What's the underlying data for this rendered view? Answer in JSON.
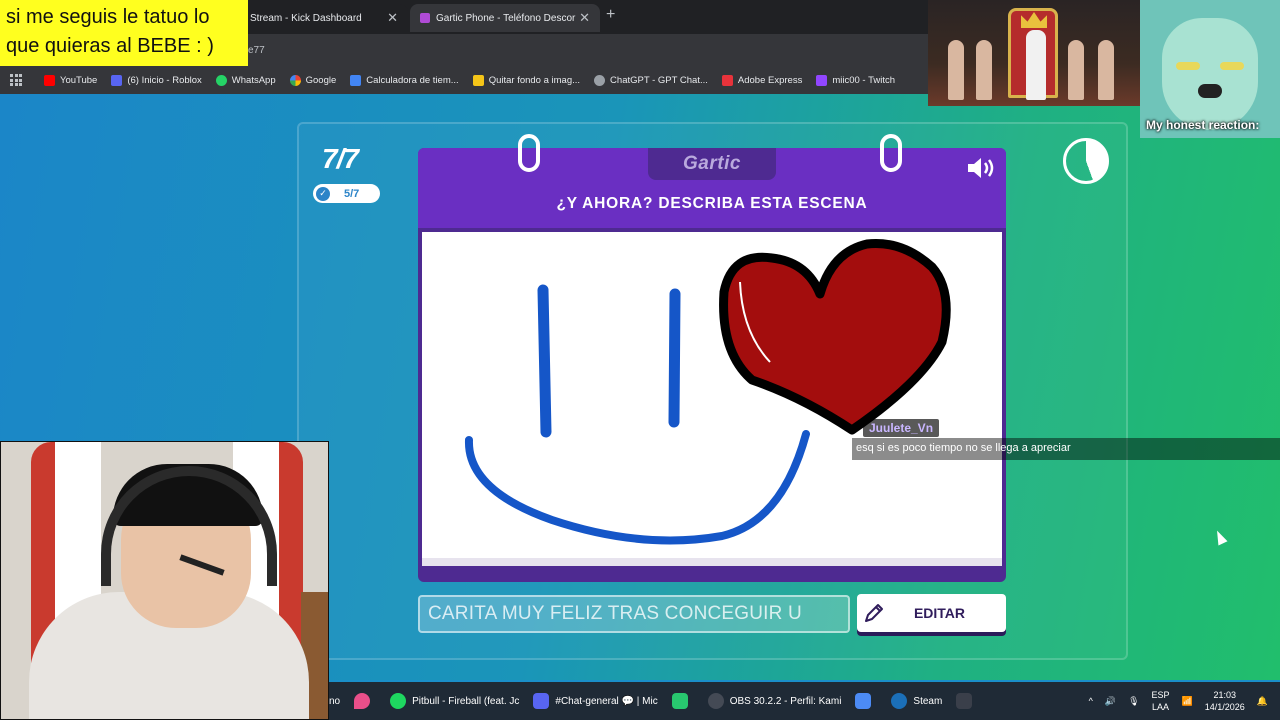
{
  "browser": {
    "tabs": [
      {
        "title": "Stream - Kick Dashboard"
      },
      {
        "title": "Gartic Phone - Teléfono Descor"
      }
    ],
    "address_partial": "e77",
    "bookmarks": [
      {
        "label": "YouTube",
        "color": "#ff0000"
      },
      {
        "label": "(6) Inicio - Roblox",
        "color": "#5865f2"
      },
      {
        "label": "WhatsApp",
        "color": "#25d366"
      },
      {
        "label": "Google",
        "color": "#ffffff"
      },
      {
        "label": "Calculadora de tiem...",
        "color": "#4285f4"
      },
      {
        "label": "Quitar fondo a imag...",
        "color": "#f5c518"
      },
      {
        "label": "ChatGPT - GPT Chat...",
        "color": "#9aa0a6"
      },
      {
        "label": "Adobe Express",
        "color": "#e8333b"
      },
      {
        "label": "miic00 - Twitch",
        "color": "#9146ff"
      }
    ]
  },
  "game": {
    "round": "7/7",
    "done_count": "5/7",
    "logo": "Gartic",
    "instruction": "¿Y AHORA? DESCRIBA ESTA ESCENA",
    "answer_text": "CARITA MUY FELIZ TRAS CONCEGUIR  U",
    "edit_label": "EDITAR"
  },
  "overlays": {
    "banner_text": "si me seguis le tatuo lo que quieras al BEBE : )",
    "reaction_text": "My honest reaction:",
    "chat": {
      "username": "Juulete_Vn",
      "message": "esq si es poco tiempo no se llega a apreciar"
    }
  },
  "taskbar": {
    "items": [
      {
        "label": "no",
        "color": "#1f2a36"
      },
      {
        "label": "",
        "color": "#e94f8a"
      },
      {
        "label": "Pitbull - Fireball (feat. Jc",
        "color": "#1ed760"
      },
      {
        "label": "#Chat-general 💬 | Mic",
        "color": "#5865f2"
      },
      {
        "label": "",
        "color": "#28c76f"
      },
      {
        "label": "OBS 30.2.2 - Perfil: Kami",
        "color": "#444a55"
      },
      {
        "label": "",
        "color": "#4c8bf5"
      },
      {
        "label": "Steam",
        "color": "#1b6fb8"
      },
      {
        "label": "",
        "color": "#3a3f4a"
      }
    ],
    "lang_top": "ESP",
    "lang_bottom": "LAA",
    "time": "21:03",
    "date": "14/1/2026"
  },
  "colors": {
    "card_purple": "#6a2fc2",
    "card_dark": "#4e2a91",
    "drawing_blue": "#1556c8",
    "heart_red": "#a30d0d"
  }
}
